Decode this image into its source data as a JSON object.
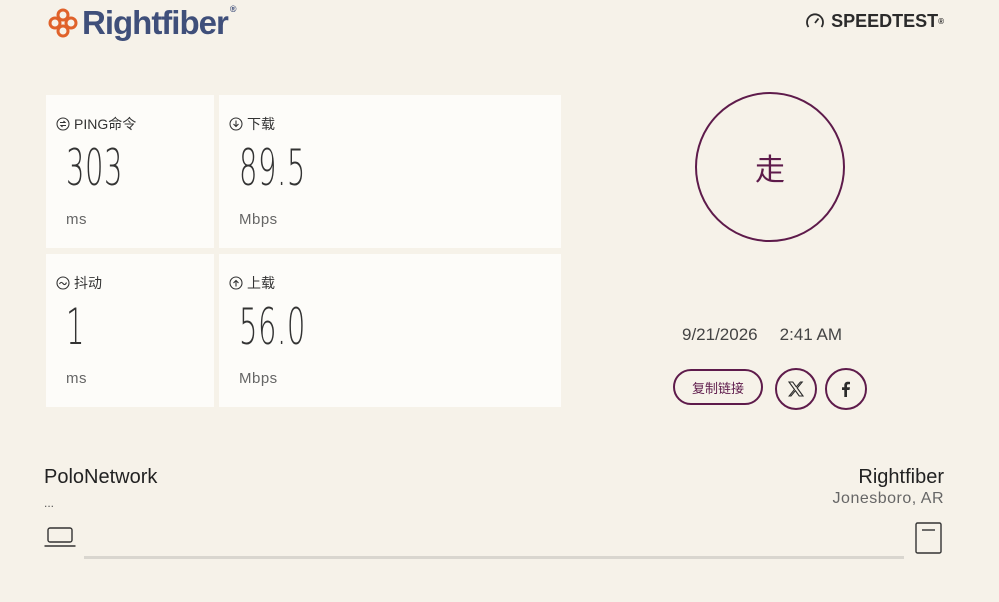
{
  "brand": {
    "name": "Rightfiber",
    "trademark": "®",
    "accent": "#e0622a",
    "text_color": "#3f4f7a"
  },
  "speedtest": {
    "label": "SPEEDTEST",
    "trademark": "®"
  },
  "metrics": {
    "ping": {
      "label": "PING命令",
      "value": "303",
      "unit": "ms",
      "icon": "ping-icon"
    },
    "download": {
      "label": "下载",
      "value": "89.5",
      "unit": "Mbps",
      "icon": "download-arrow-icon"
    },
    "jitter": {
      "label": "抖动",
      "value": "1",
      "unit": "ms",
      "icon": "jitter-icon"
    },
    "upload": {
      "label": "上载",
      "value": "56.0",
      "unit": "Mbps",
      "icon": "upload-arrow-icon"
    }
  },
  "go_button": {
    "label": "走",
    "color": "#5e1b4b"
  },
  "result": {
    "date": "9/21/2026",
    "time": "2:41 AM"
  },
  "share": {
    "copy_link_label": "复制链接",
    "icons": [
      "x-logo-icon",
      "facebook-icon"
    ]
  },
  "connection": {
    "isp_name": "PoloNetwork",
    "isp_ip": "...",
    "server_name": "Rightfiber",
    "server_location": "Jonesboro, AR"
  }
}
